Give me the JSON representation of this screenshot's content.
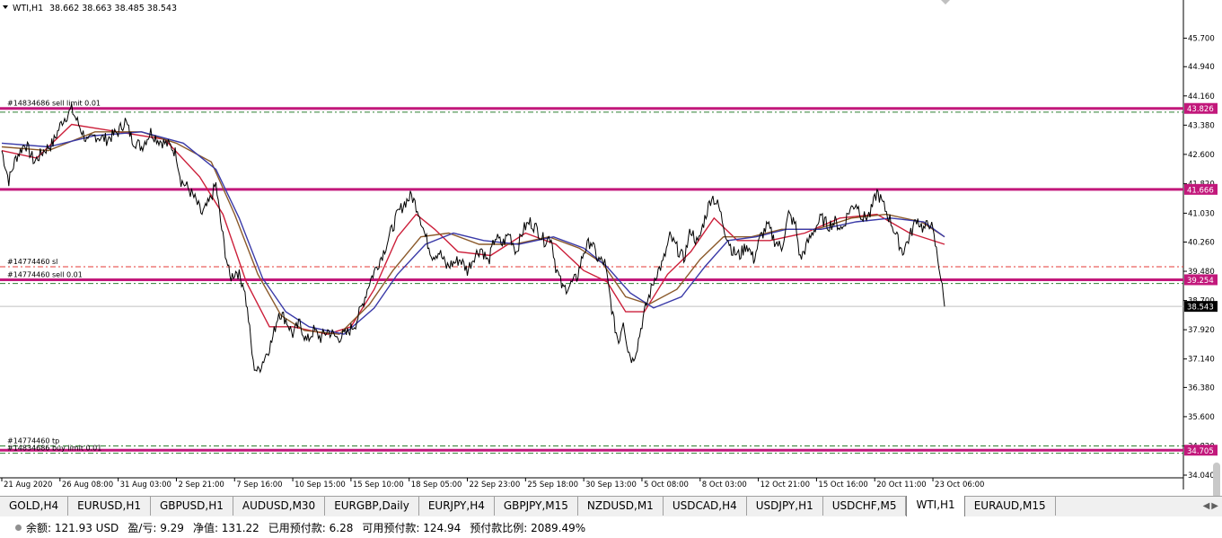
{
  "header": {
    "symbol": "WTI,H1",
    "ohlc": "38.662 38.663 38.485 38.543"
  },
  "chart_data": {
    "type": "candlestick-line",
    "symbol": "WTI",
    "timeframe": "H1",
    "ylim": [
      34.04,
      46.48
    ],
    "y_ticks": [
      "45.700",
      "44.940",
      "44.160",
      "43.380",
      "42.600",
      "41.820",
      "41.030",
      "40.260",
      "39.480",
      "38.700",
      "37.920",
      "37.140",
      "36.380",
      "35.600",
      "34.820",
      "34.040"
    ],
    "x_ticks": [
      "21 Aug 2020",
      "26 Aug 08:00",
      "31 Aug 03:00",
      "2 Sep 21:00",
      "7 Sep 16:00",
      "10 Sep 15:00",
      "15 Sep 10:00",
      "18 Sep 05:00",
      "22 Sep 23:00",
      "25 Sep 18:00",
      "30 Sep 13:00",
      "5 Oct 08:00",
      "8 Oct 03:00",
      "12 Oct 21:00",
      "15 Oct 16:00",
      "20 Oct 11:00",
      "23 Oct 06:00"
    ],
    "x_tick_index": [
      0,
      25,
      50,
      75,
      100,
      125,
      150,
      175,
      200,
      225,
      250,
      275,
      300,
      325,
      350,
      375,
      400
    ],
    "last_index": 405,
    "price_series": {
      "name": "Close",
      "points": [
        [
          0,
          42.7
        ],
        [
          3,
          41.9
        ],
        [
          6,
          42.5
        ],
        [
          10,
          42.9
        ],
        [
          14,
          42.4
        ],
        [
          18,
          42.7
        ],
        [
          22,
          42.9
        ],
        [
          26,
          43.5
        ],
        [
          30,
          43.8
        ],
        [
          33,
          43.4
        ],
        [
          37,
          42.9
        ],
        [
          40,
          43.1
        ],
        [
          45,
          43.0
        ],
        [
          50,
          43.2
        ],
        [
          53,
          43.5
        ],
        [
          56,
          43.0
        ],
        [
          60,
          42.8
        ],
        [
          64,
          43.2
        ],
        [
          67,
          43.0
        ],
        [
          70,
          42.9
        ],
        [
          73,
          42.8
        ],
        [
          75,
          42.6
        ],
        [
          77,
          41.9
        ],
        [
          80,
          41.7
        ],
        [
          83,
          41.4
        ],
        [
          86,
          41.0
        ],
        [
          89,
          41.3
        ],
        [
          92,
          41.8
        ],
        [
          94,
          40.8
        ],
        [
          96,
          40.0
        ],
        [
          98,
          39.3
        ],
        [
          101,
          39.5
        ],
        [
          104,
          39.1
        ],
        [
          106,
          38.2
        ],
        [
          108,
          37.0
        ],
        [
          110,
          36.8
        ],
        [
          113,
          37.2
        ],
        [
          116,
          37.6
        ],
        [
          119,
          38.4
        ],
        [
          122,
          38.2
        ],
        [
          125,
          37.8
        ],
        [
          128,
          38.1
        ],
        [
          131,
          37.6
        ],
        [
          134,
          37.9
        ],
        [
          137,
          37.7
        ],
        [
          140,
          37.9
        ],
        [
          144,
          37.7
        ],
        [
          148,
          37.8
        ],
        [
          152,
          38.1
        ],
        [
          155,
          38.6
        ],
        [
          158,
          39.2
        ],
        [
          161,
          39.6
        ],
        [
          164,
          40.0
        ],
        [
          167,
          40.5
        ],
        [
          170,
          41.0
        ],
        [
          173,
          41.3
        ],
        [
          176,
          41.5
        ],
        [
          179,
          41.1
        ],
        [
          182,
          40.4
        ],
        [
          185,
          39.9
        ],
        [
          188,
          40.0
        ],
        [
          191,
          39.6
        ],
        [
          194,
          39.7
        ],
        [
          197,
          39.8
        ],
        [
          200,
          39.5
        ],
        [
          203,
          39.9
        ],
        [
          206,
          40.1
        ],
        [
          209,
          39.7
        ],
        [
          212,
          40.4
        ],
        [
          215,
          40.2
        ],
        [
          218,
          40.5
        ],
        [
          221,
          40.0
        ],
        [
          224,
          40.6
        ],
        [
          227,
          40.8
        ],
        [
          230,
          40.6
        ],
        [
          233,
          40.3
        ],
        [
          236,
          40.4
        ],
        [
          238,
          39.6
        ],
        [
          241,
          39.0
        ],
        [
          244,
          39.1
        ],
        [
          247,
          39.3
        ],
        [
          250,
          40.0
        ],
        [
          253,
          40.3
        ],
        [
          256,
          39.8
        ],
        [
          259,
          39.7
        ],
        [
          261,
          38.9
        ],
        [
          263,
          38.1
        ],
        [
          265,
          37.6
        ],
        [
          267,
          38.2
        ],
        [
          269,
          37.4
        ],
        [
          271,
          37.1
        ],
        [
          273,
          37.5
        ],
        [
          275,
          38.1
        ],
        [
          277,
          38.6
        ],
        [
          279,
          39.0
        ],
        [
          281,
          39.4
        ],
        [
          284,
          39.7
        ],
        [
          287,
          40.4
        ],
        [
          290,
          40.1
        ],
        [
          293,
          39.8
        ],
        [
          296,
          40.6
        ],
        [
          299,
          40.2
        ],
        [
          302,
          40.9
        ],
        [
          305,
          41.5
        ],
        [
          308,
          41.2
        ],
        [
          311,
          40.5
        ],
        [
          314,
          40.0
        ],
        [
          317,
          39.9
        ],
        [
          320,
          40.2
        ],
        [
          323,
          39.8
        ],
        [
          326,
          40.4
        ],
        [
          329,
          40.7
        ],
        [
          332,
          40.3
        ],
        [
          335,
          40.1
        ],
        [
          338,
          41.0
        ],
        [
          341,
          40.7
        ],
        [
          343,
          39.8
        ],
        [
          346,
          40.2
        ],
        [
          349,
          40.6
        ],
        [
          352,
          40.9
        ],
        [
          355,
          40.7
        ],
        [
          358,
          40.8
        ],
        [
          361,
          40.6
        ],
        [
          364,
          41.1
        ],
        [
          367,
          41.3
        ],
        [
          370,
          40.9
        ],
        [
          373,
          41.0
        ],
        [
          376,
          41.6
        ],
        [
          379,
          41.2
        ],
        [
          382,
          40.8
        ],
        [
          385,
          40.3
        ],
        [
          387,
          40.0
        ],
        [
          390,
          40.4
        ],
        [
          393,
          40.9
        ],
        [
          396,
          40.6
        ],
        [
          399,
          40.8
        ],
        [
          401,
          40.2
        ],
        [
          403,
          39.5
        ],
        [
          405,
          38.54
        ]
      ]
    },
    "ma_series": [
      {
        "color": "#cc1f3a",
        "points": [
          [
            0,
            42.7
          ],
          [
            15,
            42.5
          ],
          [
            30,
            43.4
          ],
          [
            50,
            43.2
          ],
          [
            70,
            43.0
          ],
          [
            85,
            42.0
          ],
          [
            95,
            41.0
          ],
          [
            105,
            39.2
          ],
          [
            115,
            38.0
          ],
          [
            125,
            38.0
          ],
          [
            140,
            37.8
          ],
          [
            150,
            38.0
          ],
          [
            160,
            39.0
          ],
          [
            170,
            40.4
          ],
          [
            178,
            41.0
          ],
          [
            186,
            40.6
          ],
          [
            196,
            40.0
          ],
          [
            210,
            39.9
          ],
          [
            225,
            40.5
          ],
          [
            238,
            40.2
          ],
          [
            250,
            39.5
          ],
          [
            260,
            39.2
          ],
          [
            268,
            38.4
          ],
          [
            276,
            38.4
          ],
          [
            286,
            39.4
          ],
          [
            296,
            40.0
          ],
          [
            306,
            40.9
          ],
          [
            316,
            40.3
          ],
          [
            330,
            40.3
          ],
          [
            345,
            40.5
          ],
          [
            360,
            40.9
          ],
          [
            376,
            41.0
          ],
          [
            390,
            40.5
          ],
          [
            405,
            40.2
          ]
        ]
      },
      {
        "color": "#8b5a2b",
        "points": [
          [
            0,
            42.8
          ],
          [
            20,
            42.7
          ],
          [
            40,
            43.2
          ],
          [
            60,
            43.2
          ],
          [
            75,
            42.9
          ],
          [
            90,
            42.4
          ],
          [
            100,
            41.0
          ],
          [
            110,
            39.4
          ],
          [
            120,
            38.3
          ],
          [
            130,
            37.9
          ],
          [
            145,
            37.8
          ],
          [
            158,
            38.6
          ],
          [
            168,
            39.5
          ],
          [
            180,
            40.4
          ],
          [
            192,
            40.5
          ],
          [
            205,
            40.2
          ],
          [
            220,
            40.2
          ],
          [
            235,
            40.4
          ],
          [
            248,
            40.1
          ],
          [
            258,
            39.7
          ],
          [
            268,
            38.8
          ],
          [
            278,
            38.6
          ],
          [
            290,
            39.0
          ],
          [
            300,
            39.8
          ],
          [
            310,
            40.4
          ],
          [
            322,
            40.4
          ],
          [
            335,
            40.6
          ],
          [
            350,
            40.6
          ],
          [
            365,
            40.9
          ],
          [
            380,
            41.0
          ],
          [
            395,
            40.8
          ],
          [
            405,
            40.4
          ]
        ]
      },
      {
        "color": "#3a3aa8",
        "points": [
          [
            0,
            42.9
          ],
          [
            20,
            42.8
          ],
          [
            40,
            43.1
          ],
          [
            60,
            43.2
          ],
          [
            78,
            42.9
          ],
          [
            92,
            42.2
          ],
          [
            102,
            40.9
          ],
          [
            112,
            39.3
          ],
          [
            122,
            38.4
          ],
          [
            132,
            38.0
          ],
          [
            147,
            37.8
          ],
          [
            160,
            38.5
          ],
          [
            170,
            39.4
          ],
          [
            182,
            40.2
          ],
          [
            194,
            40.5
          ],
          [
            207,
            40.3
          ],
          [
            222,
            40.2
          ],
          [
            237,
            40.4
          ],
          [
            250,
            40.1
          ],
          [
            260,
            39.6
          ],
          [
            270,
            38.9
          ],
          [
            280,
            38.5
          ],
          [
            292,
            38.8
          ],
          [
            302,
            39.6
          ],
          [
            312,
            40.3
          ],
          [
            324,
            40.4
          ],
          [
            337,
            40.6
          ],
          [
            352,
            40.6
          ],
          [
            367,
            40.8
          ],
          [
            382,
            40.9
          ],
          [
            396,
            40.8
          ],
          [
            405,
            40.4
          ]
        ]
      }
    ],
    "order_lines": [
      {
        "label": "#14834686 sell limit 0.01",
        "price": 43.826,
        "tag": "43.826",
        "line_color": "#c2187b",
        "dash_color": "#2e7d32",
        "dash_offset": -0.1
      },
      {
        "label": "",
        "price": 41.666,
        "tag": "41.666",
        "line_color": "#c2187b",
        "dash_color": "",
        "dash_offset": 0
      },
      {
        "label": "#14774460 sell 0.01",
        "price": 39.254,
        "tag": "39.254",
        "line_color": "#c2187b",
        "dash_color": "#2e7d32",
        "dash_offset": -0.1
      },
      {
        "label": "",
        "price": 34.705,
        "tag": "34.705",
        "line_color": "#c2187b",
        "dash_color": "#2e7d32",
        "dash_offset": -0.08
      }
    ],
    "sl_line": {
      "label": "#14774460 sl",
      "price": 39.6,
      "color": "#e53935"
    },
    "tp_line": {
      "label": "#14774460 tp",
      "price": 34.82,
      "color": "#2e7d32"
    },
    "tp_overlap_label": "#14834686 buy limit 0.01",
    "current_price": {
      "tag": "38.543",
      "price": 38.543
    }
  },
  "tabs": [
    {
      "label": "GOLD,H4",
      "active": false
    },
    {
      "label": "EURUSD,H1",
      "active": false
    },
    {
      "label": "GBPUSD,H1",
      "active": false
    },
    {
      "label": "AUDUSD,M30",
      "active": false
    },
    {
      "label": "EURGBP,Daily",
      "active": false
    },
    {
      "label": "EURJPY,H4",
      "active": false
    },
    {
      "label": "GBPJPY,M15",
      "active": false
    },
    {
      "label": "NZDUSD,M1",
      "active": false
    },
    {
      "label": "USDCAD,H4",
      "active": false
    },
    {
      "label": "USDJPY,H1",
      "active": false
    },
    {
      "label": "USDCHF,M5",
      "active": false
    },
    {
      "label": "WTI,H1",
      "active": true
    },
    {
      "label": "EURAUD,M15",
      "active": false
    }
  ],
  "status": {
    "close_glyph": "×",
    "balance": "余额: 121.93 USD",
    "profit": "盈/亏: 9.29",
    "equity": "净值: 131.22",
    "margin": "已用预付款: 6.28",
    "free_margin": "可用预付款: 124.94",
    "margin_level": "预付款比例: 2089.49%"
  }
}
